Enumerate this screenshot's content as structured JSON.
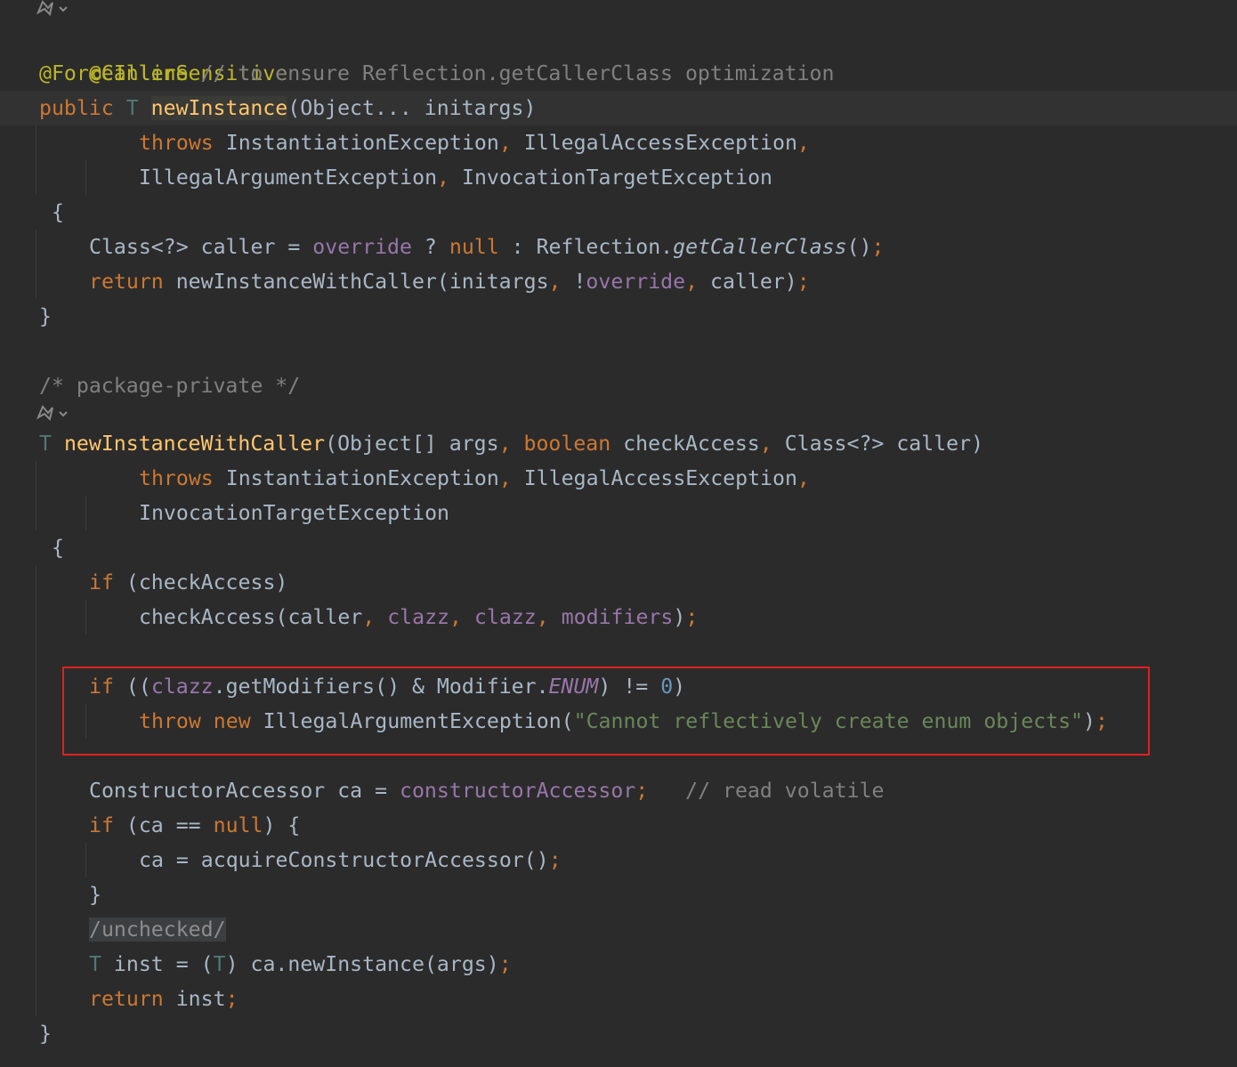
{
  "editor": {
    "code": {
      "annotation_caller_sensitive": "@CallerSensitive",
      "annotation_force_inline": "@ForceInline",
      "comment_reflection": "// to ensure Reflection.getCallerClass optimization",
      "kw_public": "public",
      "type_T": "T",
      "method_new_instance": "newInstance",
      "params_new_instance": "(Object... initargs)",
      "kw_throws": "throws",
      "exc_instantiation": "InstantiationException",
      "comma": ",",
      "exc_illegal_access": "IllegalAccessException",
      "exc_illegal_argument": "IllegalArgumentException",
      "exc_invocation_target": "InvocationTargetException",
      "brace_open": "{",
      "brace_close": "}",
      "class_caller_decl": "Class<?> caller = ",
      "field_override": "override",
      "ternary_q": " ? ",
      "kw_null": "null",
      "ternary_colon": " : Reflection.",
      "method_get_caller_class": "getCallerClass",
      "parens": "()",
      "semicolon": ";",
      "kw_return": "return",
      "call_with_caller": " newInstanceWithCaller(initargs",
      "not_op": " !",
      "caller_close": " caller)",
      "comment_package_private": "/* package-private */",
      "method_with_caller": "newInstanceWithCaller",
      "params_with_caller_a": "(Object[] args",
      "kw_boolean": "boolean",
      "params_with_caller_b": " checkAccess",
      "params_with_caller_c": " Class<?> caller)",
      "kw_if": "if",
      "cond_check_access": " (checkAccess)",
      "call_check_access": "checkAccess(caller",
      "field_clazz": "clazz",
      "field_modifiers": "modifiers",
      "close_paren": ")",
      "enum_cond_open": " ((",
      "enum_get_modifiers": ".getModifiers() & Modifier.",
      "field_enum": "ENUM",
      "enum_neq": ") != ",
      "num_zero": "0",
      "kw_throw": "throw",
      "kw_new": "new",
      "throw_exc_open": " IllegalArgumentException(",
      "str_enum_message": "\"Cannot reflectively create enum objects\"",
      "accessor_decl": "ConstructorAccessor ca = ",
      "field_constructor_accessor": "constructorAccessor",
      "comment_read_volatile": "// read volatile",
      "cond_ca_open": " (ca == ",
      "cond_ca_close": ") {",
      "assign_ca": "ca = acquireConstructorAccessor()",
      "unchecked": "/unchecked/",
      "inst_decl": " inst = (",
      "inst_cast_close": ") ca.newInstance(args)",
      "return_inst": " inst"
    }
  },
  "colors": {
    "background": "#2b2b2b",
    "keyword": "#cc7832",
    "annotation": "#bbb529",
    "method": "#ffc66d",
    "field": "#9876aa",
    "number": "#6897bb",
    "string": "#6a8759",
    "comment": "#808080",
    "type_param": "#507874",
    "text": "#a9b7c6",
    "highlight_box": "#e02020"
  },
  "icons": {
    "gutter": "implementation-gutter-icon",
    "chevron": "chevron-down-icon"
  }
}
